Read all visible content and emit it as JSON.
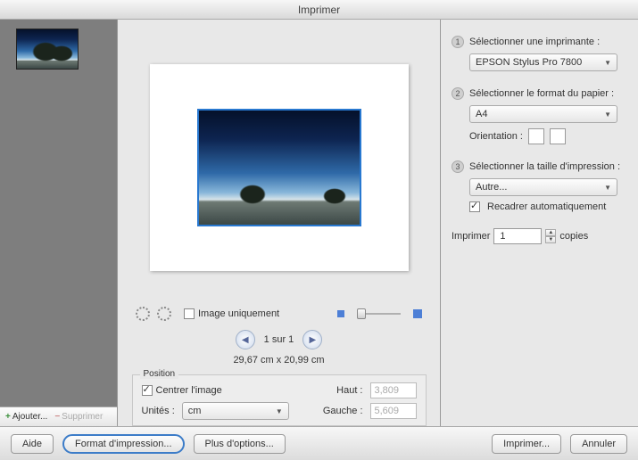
{
  "window": {
    "title": "Imprimer"
  },
  "sidebar": {
    "add_label": "Ajouter...",
    "remove_label": "Supprimer"
  },
  "center": {
    "image_only_label": "Image uniquement",
    "pager_text": "1 sur 1",
    "dimensions": "29,67 cm x 20,99 cm"
  },
  "position": {
    "legend": "Position",
    "center_image_label": "Centrer l'image",
    "units_label": "Unités :",
    "units_value": "cm",
    "top_label": "Haut :",
    "top_value": "3,809",
    "left_label": "Gauche :",
    "left_value": "5,609"
  },
  "right": {
    "step1_label": "Sélectionner une imprimante :",
    "printer_value": "EPSON Stylus Pro 7800",
    "step2_label": "Sélectionner le format du papier :",
    "paper_value": "A4",
    "orientation_label": "Orientation :",
    "step3_label": "Sélectionner la taille d'impression :",
    "size_value": "Autre...",
    "recrop_label": "Recadrer automatiquement",
    "copies_prefix": "Imprimer",
    "copies_value": "1",
    "copies_suffix": "copies"
  },
  "footer": {
    "help": "Aide",
    "page_setup": "Format d'impression...",
    "more_options": "Plus d'options...",
    "print": "Imprimer...",
    "cancel": "Annuler"
  }
}
